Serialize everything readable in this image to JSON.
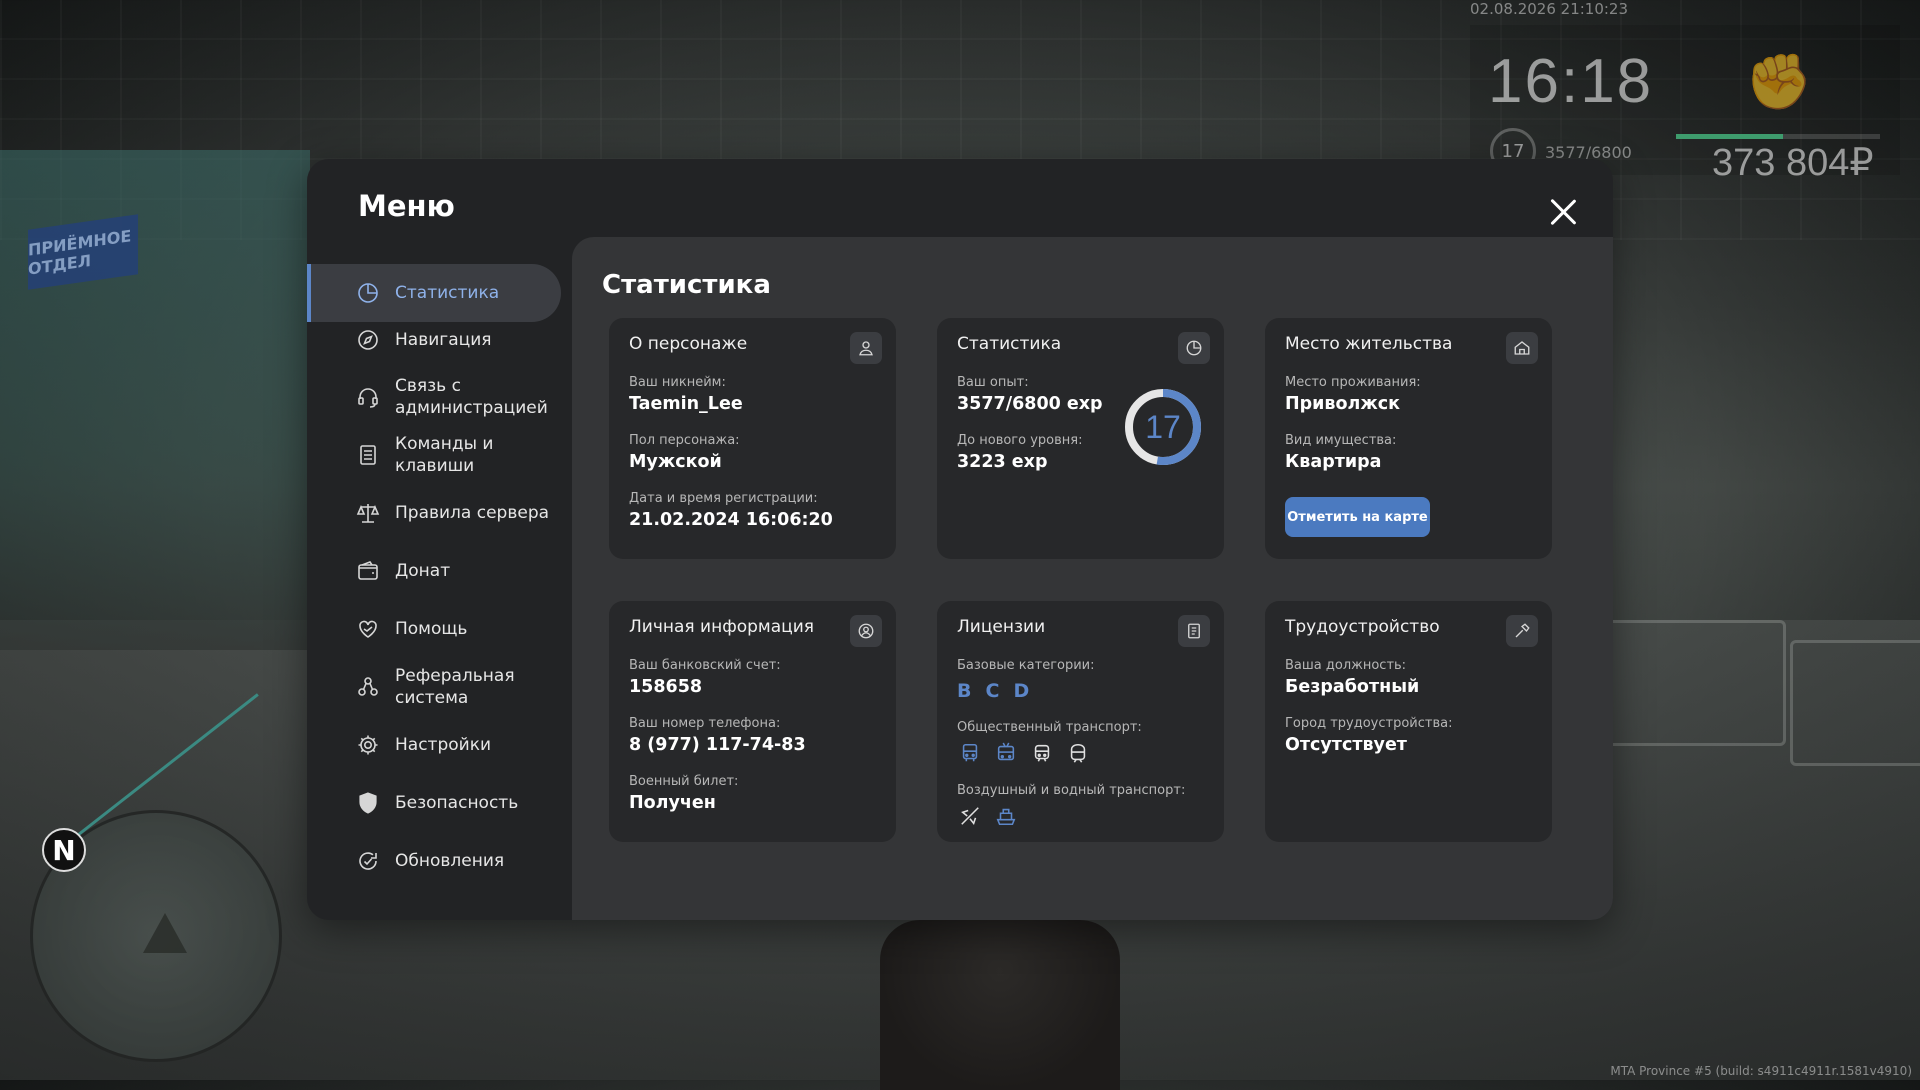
{
  "hud": {
    "datetime": "02.08.2026 21:10:23",
    "time": "16:18",
    "level": "17",
    "exp": "3577/6800",
    "exp_progress": 0.526,
    "money": "373 804₽",
    "build_info": "MTA Province #5 (build: s4911c4911r.1581v4910)",
    "background_sign": "ПРИЁМНОЕ ОТДЕЛ"
  },
  "menu": {
    "title": "Меню",
    "nav": [
      {
        "label": "Статистика",
        "icon": "pie-chart-icon",
        "active": true
      },
      {
        "label": "Навигация",
        "icon": "compass-icon"
      },
      {
        "label": "Связь с\nадминистрацией",
        "icon": "headset-icon"
      },
      {
        "label": "Команды и\nклавиши",
        "icon": "document-list-icon"
      },
      {
        "label": "Правила сервера",
        "icon": "scales-icon"
      },
      {
        "label": "Донат",
        "icon": "wallet-icon"
      },
      {
        "label": "Помощь",
        "icon": "heart-hand-icon"
      },
      {
        "label": "Реферальная\nсистема",
        "icon": "referral-icon"
      },
      {
        "label": "Настройки",
        "icon": "gear-icon"
      },
      {
        "label": "Безопасность",
        "icon": "shield-icon"
      },
      {
        "label": "Обновления",
        "icon": "refresh-check-icon"
      }
    ]
  },
  "content": {
    "title": "Статистика",
    "character": {
      "title": "О персонаже",
      "nickname_label": "Ваш никнейм:",
      "nickname": "Taemin_Lee",
      "gender_label": "Пол персонажа:",
      "gender": "Мужской",
      "reg_label": "Дата и время регистрации:",
      "reg": "21.02.2024 16:06:20"
    },
    "stats": {
      "title": "Статистика",
      "exp_label": "Ваш опыт:",
      "exp": "3577/6800 exp",
      "next_label": "До нового уровня:",
      "next": "3223 exp",
      "level": "17",
      "progress": 0.526
    },
    "residence": {
      "title": "Место жительства",
      "place_label": "Место проживания:",
      "place": "Приволжск",
      "property_label": "Вид имущества:",
      "property": "Квартира",
      "button": "Отметить на карте"
    },
    "personal": {
      "title": "Личная информация",
      "bank_label": "Ваш банковский счет:",
      "bank": "158658",
      "phone_label": "Ваш номер телефона:",
      "phone": "8 (977) 117-74-83",
      "military_label": "Военный билет:",
      "military": "Получен"
    },
    "licenses": {
      "title": "Лицензии",
      "base_label": "Базовые категории:",
      "categories": [
        "B",
        "C",
        "D"
      ],
      "public_label": "Общественный транспорт:",
      "public_icons": [
        "bus-icon",
        "trolleybus-icon",
        "tram-icon",
        "subway-icon"
      ],
      "air_label": "Воздушный и водный транспорт:",
      "air_icons": [
        "plane-icon",
        "boat-icon"
      ]
    },
    "employment": {
      "title": "Трудоустройство",
      "position_label": "Ваша должность:",
      "position": "Безработный",
      "city_label": "Город трудоустройства:",
      "city": "Отсутствует"
    }
  },
  "colors": {
    "accent": "#5c86c8",
    "panel": "#222325",
    "content": "#343537",
    "card": "#27282a"
  }
}
